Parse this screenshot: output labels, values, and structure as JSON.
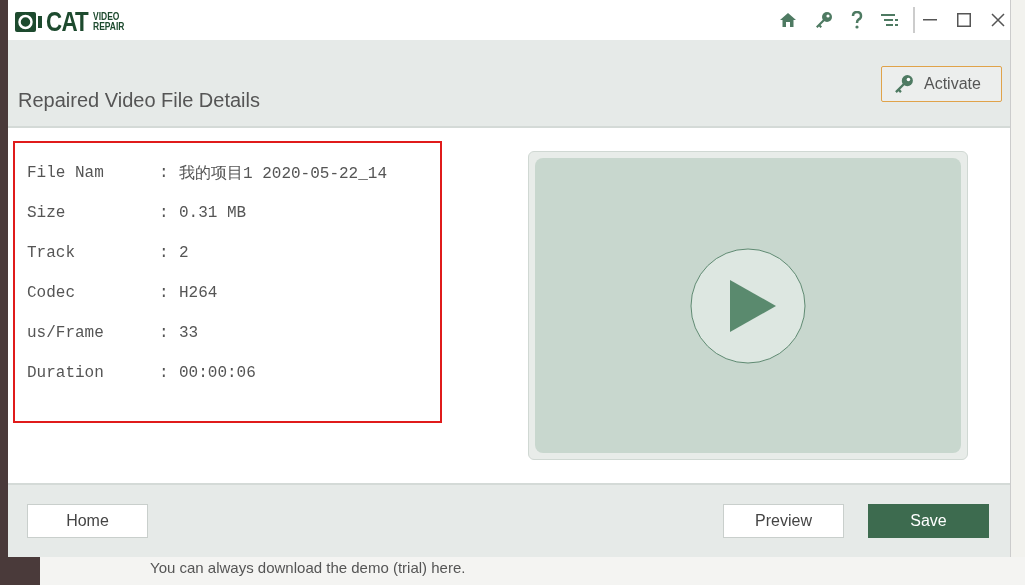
{
  "logo": {
    "mark": "CAT",
    "line1": "VIDEO",
    "line2": "REPAIR"
  },
  "title_bar": {
    "icons": [
      {
        "kind": "home"
      },
      {
        "kind": "key"
      },
      {
        "kind": "help"
      },
      {
        "kind": "menu"
      }
    ],
    "window_controls": [
      {
        "kind": "minimize"
      },
      {
        "kind": "maximize"
      },
      {
        "kind": "close"
      }
    ]
  },
  "header": {
    "title": "Repaired Video File Details",
    "activate_button": "Activate"
  },
  "details": [
    {
      "label": "File Nam",
      "separator": ":",
      "value": "我的项目1 2020-05-22_14"
    },
    {
      "label": "Size",
      "separator": ":",
      "value": "0.31 MB"
    },
    {
      "label": "Track",
      "separator": ":",
      "value": "2"
    },
    {
      "label": "Codec",
      "separator": ":",
      "value": "H264"
    },
    {
      "label": "us/Frame",
      "separator": ":",
      "value": "33"
    },
    {
      "label": "Duration",
      "separator": ":",
      "value": "00:00:06"
    }
  ],
  "footer": {
    "buttons": [
      {
        "label": "Home",
        "kind": "plain"
      },
      {
        "label": "Preview",
        "kind": "plain"
      },
      {
        "label": "Save",
        "kind": "primary"
      }
    ]
  },
  "background_text": "You can always download the demo (trial) here."
}
